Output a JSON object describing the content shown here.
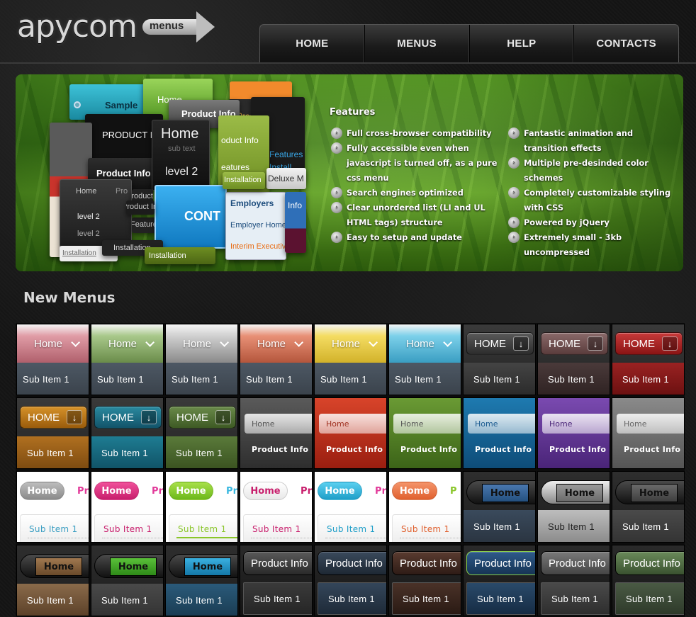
{
  "header": {
    "logo_text": "apycom",
    "logo_badge": "menus",
    "nav": [
      "HOME",
      "MENUS",
      "HELP",
      "CONTACTS"
    ]
  },
  "banner": {
    "collage": {
      "sample": "Sample",
      "home_a": "Home",
      "product_info_a": "Product Info",
      "product_info_b": "PRODUCT INFO",
      "home_big": "Home",
      "sub_text": "sub text",
      "level2_big": "level 2",
      "product_info_c": "Product Info",
      "product_info_d": "Product Info",
      "product_short": "Product",
      "features_a": "Features",
      "features_b": "Features",
      "install_a": "Install",
      "install_b": "Installation",
      "deluxe": "Deluxe M",
      "home_small": "Home",
      "pro": "Pro",
      "level2_a": "level 2",
      "level2_b": "level 2",
      "cont": "CONT",
      "employers": "Employers",
      "employer_home": "Employer Home",
      "interim": "Interim Executiv",
      "info": "Info",
      "installation_c": "Installation",
      "installation_d": "Installation",
      "installation_e": "Installation",
      "product_info_e": "Product Info",
      "features_c": "eatures",
      "product_info_f": "oduct Info"
    },
    "features_title": "Features",
    "features_left": [
      "Full cross-browser compatibility",
      "Fully accessible even when javascript is turned off, as a pure css menu",
      "Search engines optimized",
      "Clear unordered list (LI and UL HTML tags) structure",
      "Easy to setup and update"
    ],
    "features_right": [
      "Fantastic animation and transition effects",
      "Multiple pre-desinded color schemes",
      "Completely customizable styling with CSS",
      "Powered by jQuery",
      "Extremely small - 3kb uncompressed"
    ]
  },
  "section_title": "New Menus",
  "tiles": {
    "home": "Home",
    "home_caps": "HOME",
    "sub_item": "Sub Item 1",
    "product_info": "Product Info",
    "peek_pr": "Pr",
    "peek_p": "P"
  },
  "colors": {
    "accent_green": "#4f8f1f",
    "header_bg": "#141414"
  }
}
